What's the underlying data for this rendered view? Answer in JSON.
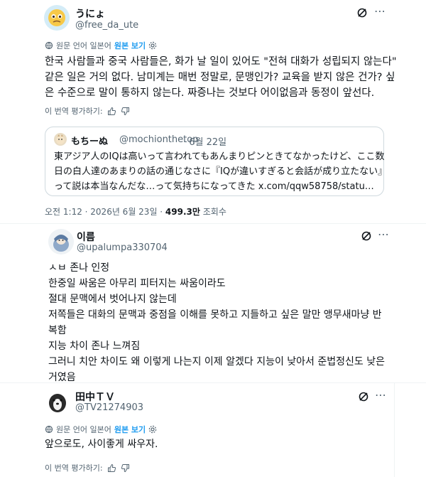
{
  "post": {
    "name": "うにょ",
    "handle": "@free_da_ute",
    "translate": {
      "label": "원문 언어 일본어",
      "link": "원본 보기"
    },
    "lines": [
      "한국 사람들과 중국 사람들은, 화가 날 일이 있어도 \"전혀 대화가 성립되지 않는다\"",
      "같은 일은 거의 없다. 남미계는 매번 정말로, 문맹인가? 교육을 받지 않은 건가? 싶",
      "은 수준으로 말이 통하지 않는다. 짜증나는 것보다 어이없음과 동정이 앞선다."
    ],
    "rate_label": "이 번역 평가하기:",
    "timestamp": "오전 1:12 · 2026년 6월 23일 · ",
    "views_value": "499.3만",
    "views_label": " 조회수"
  },
  "quote": {
    "name": "もちーぬ",
    "handle": "@mochionthetop",
    "date": "· 6월 22일",
    "lines": [
      "東アジア人のIQは高いって言われてもあんまりピンときてなかったけど、ここ数",
      "日の白人達のあまりの話の通じなさに『IQが違いすぎると会話が成り立たない』",
      "って説は本当なんだな…って気持ちになってきた x.com/qqw58758/statu…"
    ]
  },
  "reply1": {
    "name": "이름",
    "handle": "@upalumpa330704",
    "lines": [
      "ㅅㅂ 존나 인정",
      "한중일 싸움은 아무리 피터지는 싸움이라도",
      "절대 문맥에서 벗어나지 않는데",
      "저쪽들은 대화의 문맥과 중점을 이해를 못하고 지들하고 싶은 말만 앵무새마냥 반",
      "복함",
      "지능 차이 존나 느껴짐",
      "그러니 치안 차이도 왜 이렇게 나는지 이제 알겠다 지능이 낮아서 준법정신도 낮은",
      "거였음"
    ]
  },
  "reply2": {
    "name": "田中ＴＶ",
    "handle": "@TV21274903",
    "translate": {
      "label": "원문 언어 일본어",
      "link": "원본 보기"
    },
    "text": "앞으로도, 사이좋게 싸우자.",
    "rate_label": "이 번역 평가하기:"
  },
  "colors": {
    "accent": "#1d9bf0",
    "text": "#0f1419",
    "muted": "#536471",
    "border": "#cfd9de"
  },
  "icons": [
    "grok-icon",
    "more-icon",
    "translate-icon",
    "gear-icon",
    "thumbs-up-icon",
    "thumbs-down-icon"
  ]
}
